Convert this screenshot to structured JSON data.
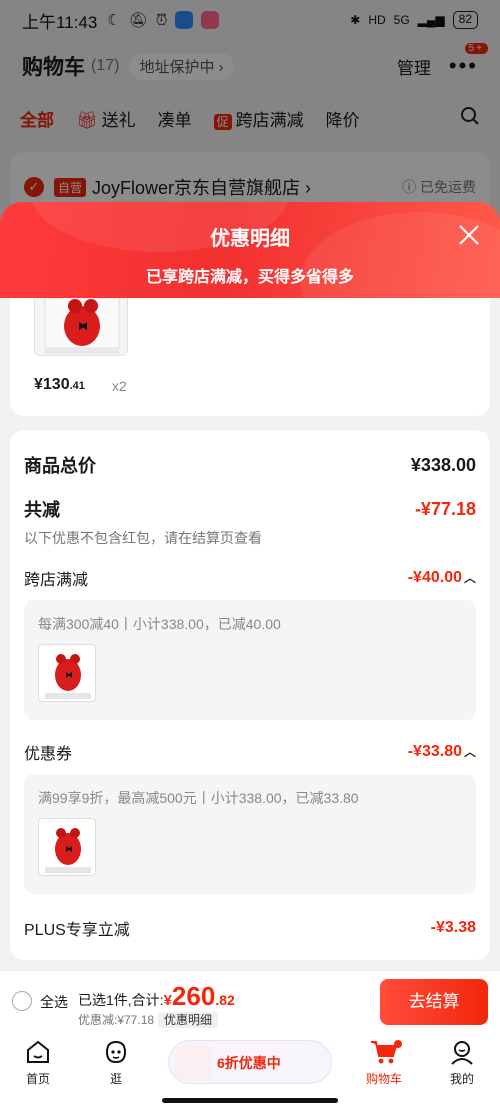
{
  "status_bar": {
    "time": "上午11:43",
    "battery": "82",
    "network": "5G"
  },
  "header": {
    "title": "购物车",
    "count": "(17)",
    "address_protect": "地址保护中 ›",
    "manage": "管理",
    "more_badge": "5+"
  },
  "filter_tabs": [
    {
      "label": "全部"
    },
    {
      "label": "送礼"
    },
    {
      "label": "凑单"
    },
    {
      "label": "跨店满减",
      "tag": "促"
    },
    {
      "label": "降价"
    }
  ],
  "store": {
    "self_tag": "自营",
    "name": "JoyFlower京东自营旗舰店 ›",
    "shipping": "已免运费"
  },
  "popup": {
    "title": "优惠明细",
    "subtitle": "已享跨店满减，买得多省得多",
    "product": {
      "price_main": "¥130",
      "price_decimal": ".41",
      "qty": "x2"
    },
    "total_label": "商品总价",
    "total_value": "¥338.00",
    "reduce_label": "共减",
    "reduce_value": "-¥77.18",
    "reduce_note": "以下优惠不包含红包，请在结算页查看",
    "sections": [
      {
        "label": "跨店满减",
        "amount": "-¥40.00",
        "desc": "每满300减40丨小计338.00，已减40.00"
      },
      {
        "label": "优惠券",
        "amount": "-¥33.80",
        "desc": "满99享9折，最高减500元丨小计338.00，已减33.80"
      }
    ],
    "plus_label": "PLUS专享立减",
    "plus_value": "-¥3.38"
  },
  "checkout": {
    "select_all": "全选",
    "selected_prefix": "已选1件,合计:",
    "total_currency": "¥",
    "total_int": "260",
    "total_dec": ".82",
    "saved": "优惠减:¥77.18",
    "detail": "优惠明细",
    "pay": "去结算"
  },
  "nav": {
    "home": "首页",
    "browse": "逛",
    "promo": "6折优惠中",
    "cart": "购物车",
    "me": "我的"
  },
  "colors": {
    "accent": "#f2270c"
  }
}
